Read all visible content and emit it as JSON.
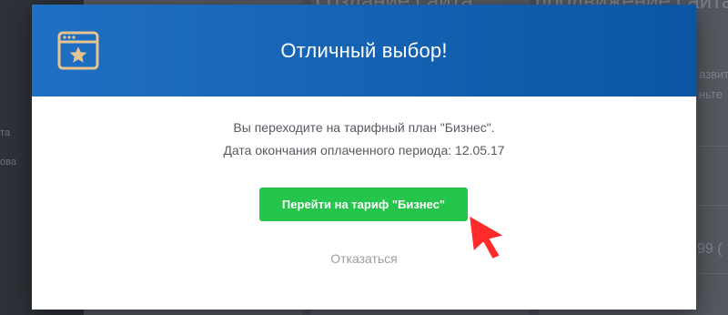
{
  "background": {
    "sidebar_fragments": [
      "та",
      "ова"
    ],
    "card_titles": [
      "создание сайта",
      "продвижение сайта"
    ],
    "right_fragments": [
      "азвит",
      "ньте",
      "99 ("
    ]
  },
  "modal": {
    "icon": "browser-star-icon",
    "title": "Отличный выбор!",
    "message_line1": "Вы переходите на тарифный план \"Бизнес\".",
    "message_line2": "Дата окончания оплаченного периода: 12.05.17",
    "confirm_label": "Перейти на тариф \"Бизнес\"",
    "decline_label": "Отказаться"
  },
  "colors": {
    "header_gradient_start": "#1f6fc4",
    "header_gradient_end": "#0b56a3",
    "icon_color": "#e7c48f",
    "confirm_button": "#25c44b",
    "pointer_arrow": "#ff2a2a"
  },
  "annotation": "red-pointer-arrow-icon"
}
